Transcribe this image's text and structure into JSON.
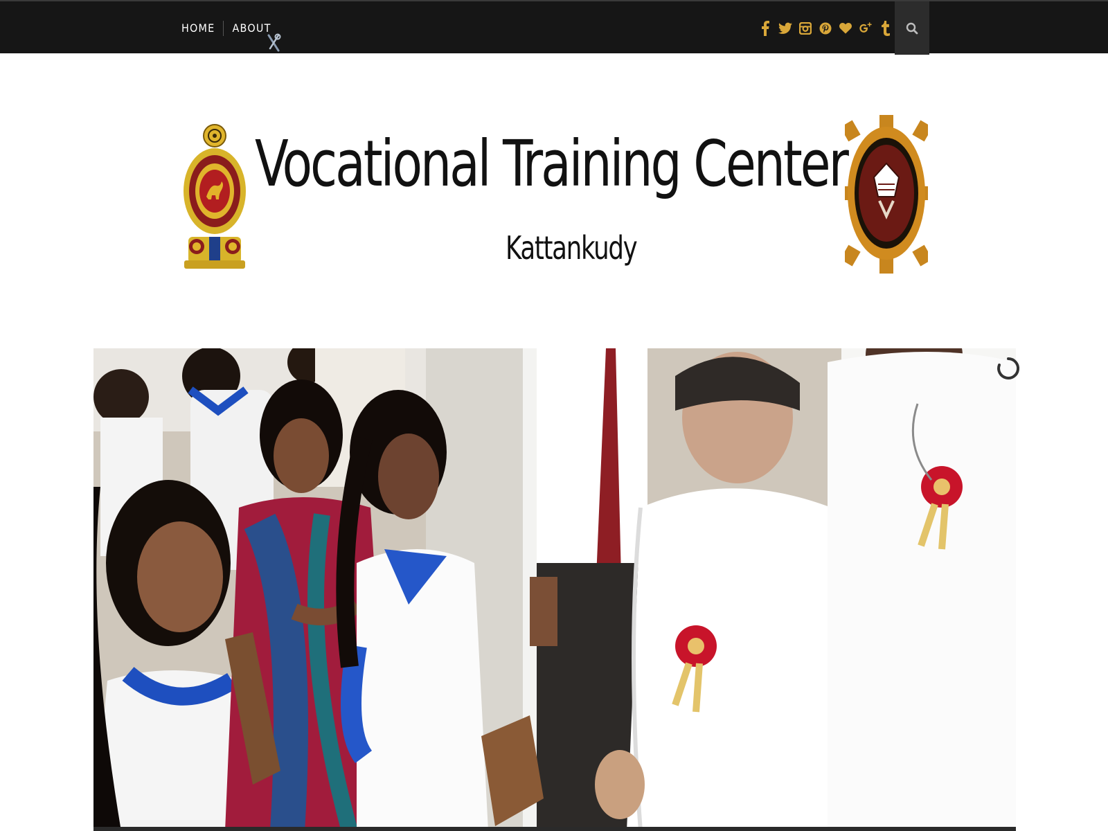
{
  "nav": {
    "items": [
      {
        "label": "HOME"
      },
      {
        "label": "ABOUT"
      }
    ]
  },
  "social": {
    "icons": [
      "facebook-icon",
      "twitter-icon",
      "instagram-icon",
      "pinterest-icon",
      "bloglovin-heart-icon",
      "google-plus-icon",
      "tumblr-icon"
    ],
    "glyphs": [
      "f",
      "",
      "",
      "",
      "♥",
      "g⁺",
      "t"
    ],
    "color": "#d9a739"
  },
  "header": {
    "title": "Vocational Training Center",
    "subtitle": "Kattankudy"
  },
  "colors": {
    "topbar": "#161616",
    "accent": "#d9a739",
    "search_bg": "#2c2c2c"
  }
}
